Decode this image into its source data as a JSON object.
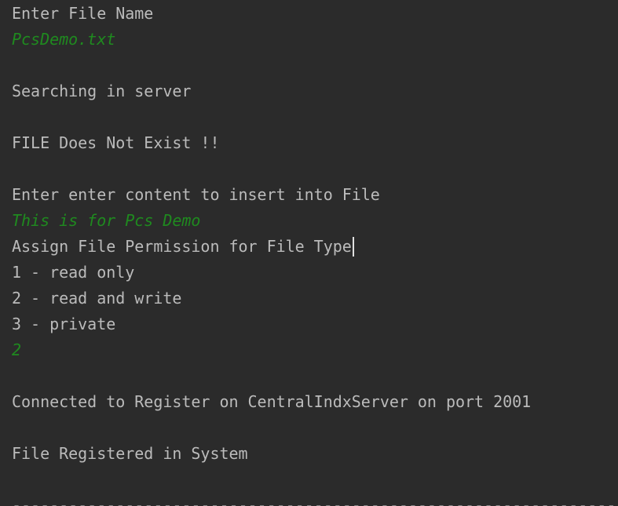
{
  "console": {
    "lines": [
      {
        "kind": "output",
        "text": "Enter File Name"
      },
      {
        "kind": "input",
        "text": "PcsDemo.txt"
      },
      {
        "kind": "blank",
        "text": ""
      },
      {
        "kind": "output",
        "text": "Searching in server"
      },
      {
        "kind": "blank",
        "text": ""
      },
      {
        "kind": "output",
        "text": "FILE Does Not Exist !!"
      },
      {
        "kind": "blank",
        "text": ""
      },
      {
        "kind": "output",
        "text": "Enter enter content to insert into File"
      },
      {
        "kind": "input",
        "text": "This is for Pcs Demo"
      },
      {
        "kind": "output",
        "text": "Assign File Permission for File Type"
      },
      {
        "kind": "output",
        "text": "1 - read only"
      },
      {
        "kind": "output",
        "text": "2 - read and write"
      },
      {
        "kind": "output",
        "text": "3 - private"
      },
      {
        "kind": "input",
        "text": "2"
      },
      {
        "kind": "blank",
        "text": ""
      },
      {
        "kind": "output",
        "text": "Connected to Register on CentralIndxServer on port 2001"
      },
      {
        "kind": "blank",
        "text": ""
      },
      {
        "kind": "output",
        "text": "File Registered in System"
      },
      {
        "kind": "blank",
        "text": ""
      },
      {
        "kind": "separator",
        "text": "-----------------------------------------------------------------"
      }
    ]
  },
  "colors": {
    "background": "#2b2b2b",
    "output_text": "#bbbbbb",
    "user_input_text": "#1f8a1f"
  }
}
